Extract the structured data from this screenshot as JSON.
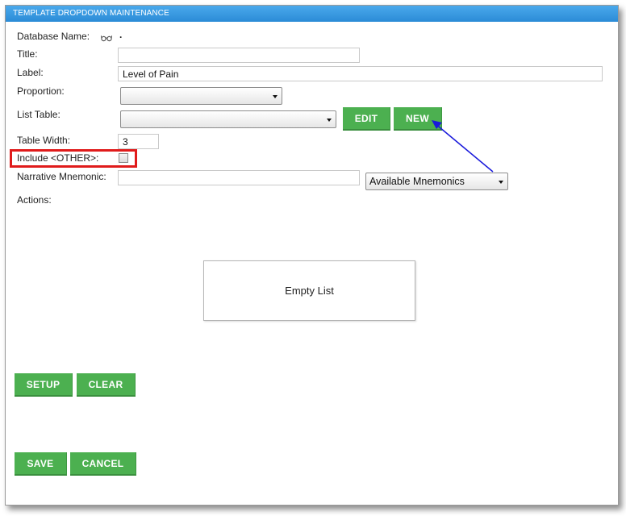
{
  "window": {
    "title": "TEMPLATE DROPDOWN MAINTENANCE"
  },
  "form": {
    "database_name": {
      "label": "Database Name:",
      "icon": "glasses-icon",
      "value": "."
    },
    "title": {
      "label": "Title:",
      "value": ""
    },
    "label": {
      "label": "Label:",
      "value": "Level of Pain"
    },
    "proportion": {
      "label": "Proportion:",
      "selected": ""
    },
    "list_table": {
      "label": "List Table:",
      "selected": "",
      "edit_button": "EDIT",
      "new_button": "NEW"
    },
    "table_width": {
      "label": "Table Width:",
      "value": "3"
    },
    "include_other": {
      "label": "Include <OTHER>:",
      "checked": false
    },
    "narrative_mnemonic": {
      "label": "Narrative Mnemonic:",
      "value": "",
      "dropdown_selected": "Available Mnemonics"
    },
    "actions": {
      "label": "Actions:",
      "empty_text": "Empty List"
    }
  },
  "buttons": {
    "setup": "SETUP",
    "clear": "CLEAR",
    "save": "SAVE",
    "cancel": "CANCEL"
  },
  "annotations": {
    "highlight_color": "#e01b1b",
    "arrow_color": "#1a1adb"
  },
  "colors": {
    "titlebar": "#3399e0",
    "button_green": "#4cb050"
  }
}
